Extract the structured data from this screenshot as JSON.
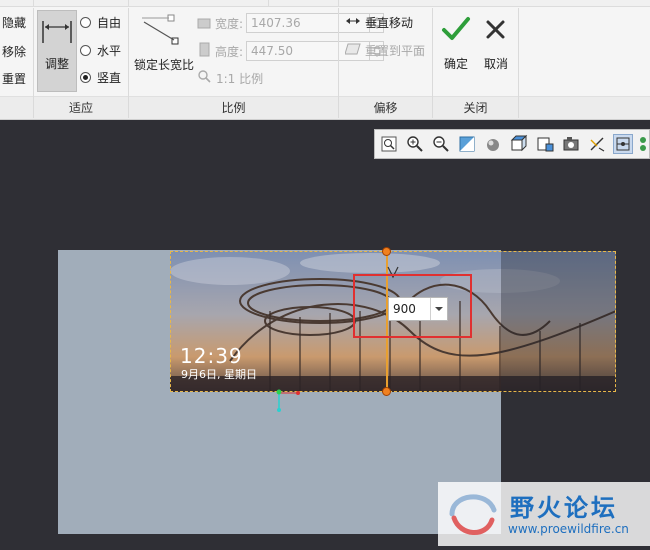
{
  "ribbon": {
    "left_group": {
      "hide": "隐藏",
      "remove": "移除",
      "reset": "重置"
    },
    "fit_group": {
      "label": "适应",
      "adjust": "调整",
      "options": [
        {
          "label": "自由",
          "selected": false
        },
        {
          "label": "水平",
          "selected": false
        },
        {
          "label": "竖直",
          "selected": true
        }
      ]
    },
    "ratio_group": {
      "label": "比例",
      "lock": "锁定长宽比",
      "width_label": "宽度:",
      "width_value": "1407.36",
      "height_label": "高度:",
      "height_value": "447.50",
      "one_to_one": "1:1 比例"
    },
    "offset_group": {
      "label": "偏移",
      "vertical_move": "垂直移动",
      "reset_to_plane": "重置到平面"
    },
    "close_group": {
      "label": "关闭",
      "ok": "确定",
      "cancel": "取消"
    }
  },
  "canvas": {
    "dimension_value": "900",
    "photo_time": "12:39",
    "photo_date": "9月6日, 星期日"
  },
  "watermark": {
    "name": "野火论坛",
    "url": "www.proewildfire.cn"
  },
  "colors": {
    "ok_green": "#2e9e3a",
    "highlight_red": "#e03030",
    "handle_orange": "#f08020",
    "watermark_blue": "#1e6fbf"
  }
}
